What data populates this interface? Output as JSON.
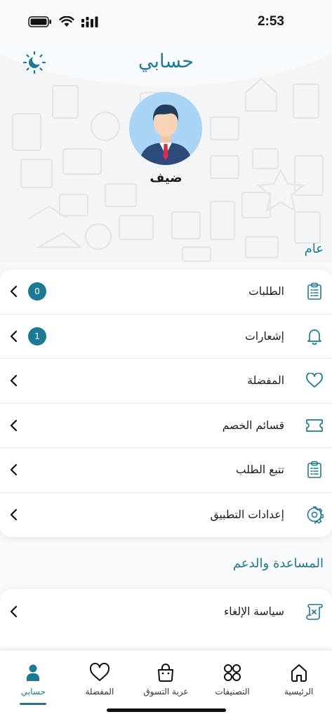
{
  "status_bar": {
    "time": "2:53"
  },
  "header": {
    "title": "حسابي",
    "guest_name": "ضيف"
  },
  "general": {
    "title": "عام",
    "items": [
      {
        "label": "الطلبات",
        "icon": "clipboard-icon",
        "badge": "0"
      },
      {
        "label": "إشعارات",
        "icon": "bell-icon",
        "badge": "1"
      },
      {
        "label": "المفضلة",
        "icon": "heart-icon"
      },
      {
        "label": "قسائم الخصم",
        "icon": "ticket-icon"
      },
      {
        "label": "تتبع الطلب",
        "icon": "clipboard-list-icon"
      },
      {
        "label": "إعدادات التطبيق",
        "icon": "gear-icon"
      }
    ]
  },
  "support": {
    "title": "المساعدة والدعم",
    "items": [
      {
        "label": "سياسة الإلغاء",
        "icon": "scroll-icon"
      }
    ]
  },
  "bottom_nav": {
    "items": [
      {
        "label": "الرئيسية",
        "icon": "home-icon"
      },
      {
        "label": "التصنيفات",
        "icon": "categories-icon"
      },
      {
        "label": "عربة التسوق",
        "icon": "shopping-bag-icon"
      },
      {
        "label": "المفضلة",
        "icon": "heart-icon"
      },
      {
        "label": "حسابي",
        "icon": "person-icon",
        "active": true
      }
    ]
  },
  "colors": {
    "accent": "#1b7a94",
    "background": "#f7f9fa"
  }
}
